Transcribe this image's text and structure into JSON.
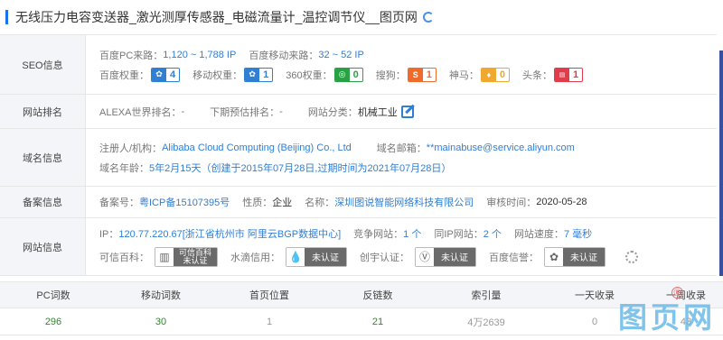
{
  "title": "无线压力电容变送器_激光测厚传感器_电磁流量计_温控调节仪__图页网",
  "seo": {
    "label": "SEO信息",
    "pc_label": "百度PC来路：",
    "pc_value": "1,120 ~ 1,788 IP",
    "mobile_label": "百度移动来路：",
    "mobile_value": "32 ~ 52 IP",
    "weights": [
      {
        "label": "百度权重：",
        "value": "4",
        "color": "blue",
        "icon": "paw-icon"
      },
      {
        "label": "移动权重：",
        "value": "1",
        "color": "blue",
        "icon": "paw-icon"
      },
      {
        "label": "360权重：",
        "value": "0",
        "color": "green",
        "icon": "360-icon"
      },
      {
        "label": "搜狗：",
        "value": "1",
        "color": "orange",
        "icon": "sogou-icon"
      },
      {
        "label": "神马：",
        "value": "0",
        "color": "amber",
        "icon": "shenma-icon"
      },
      {
        "label": "头条：",
        "value": "1",
        "color": "red",
        "icon": "toutiao-icon"
      }
    ]
  },
  "rank": {
    "label": "网站排名",
    "alexa_label": "ALEXA世界排名：",
    "alexa_value": "-",
    "predict_label": "下期预估排名：",
    "predict_value": "-",
    "category_label": "网站分类：",
    "category_value": "机械工业"
  },
  "domain": {
    "label": "域名信息",
    "registrant_label": "注册人/机构：",
    "registrant_value": "Alibaba Cloud Computing (Beijing) Co., Ltd",
    "email_label": "域名邮箱：",
    "email_value": "**mainabuse@service.aliyun.com",
    "age_label": "域名年龄：",
    "age_value": "5年2月15天（创建于2015年07月28日,过期时间为2021年07月28日）"
  },
  "beian": {
    "label": "备案信息",
    "no_label": "备案号：",
    "no_value": "粤ICP备15107395号",
    "nature_label": "性质：",
    "nature_value": "企业",
    "name_label": "名称：",
    "name_value": "深圳图说智能网络科技有限公司",
    "date_label": "审核时间：",
    "date_value": "2020-05-28"
  },
  "site": {
    "label": "网站信息",
    "ip_label": "IP：",
    "ip_value": "120.77.220.67[浙江省杭州市 阿里云BGP数据中心]",
    "compete_label": "竞争网站：",
    "compete_value": "1 个",
    "sameip_label": "同IP网站：",
    "sameip_value": "2 个",
    "speed_label": "网站速度：",
    "speed_value": "7 毫秒",
    "kexin_label": "可信百科：",
    "kexin_cert_line1": "可信百科",
    "kexin_cert_line2": "未认证",
    "shuidi_label": "水滴信用：",
    "shuidi_cert": "未认证",
    "chuangyu_label": "创宇认证：",
    "chuangyu_cert": "未认证",
    "baidu_label": "百度信誉：",
    "baidu_cert": "未认证"
  },
  "stats": {
    "headers": [
      "PC词数",
      "移动词数",
      "首页位置",
      "反链数",
      "索引量",
      "一天收录",
      "一周收录"
    ],
    "values": [
      "296",
      "30",
      "1",
      "21",
      "4万2639",
      "0",
      "43"
    ]
  },
  "watermark": "图页网",
  "watermark_mark": "®"
}
